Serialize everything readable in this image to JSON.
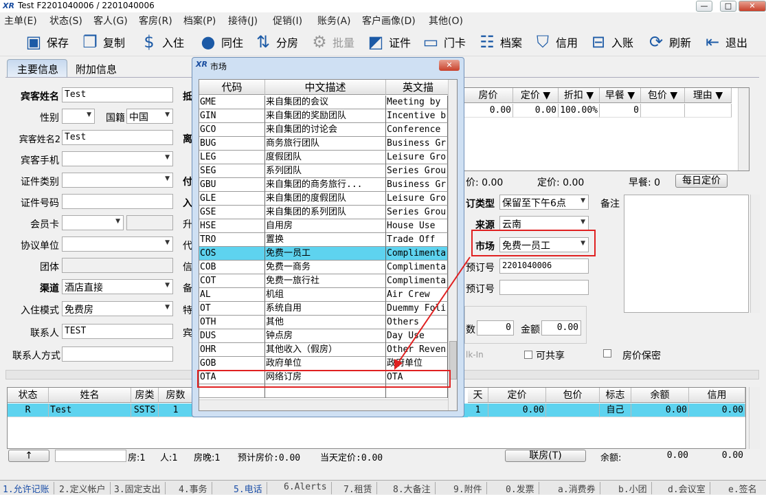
{
  "window": {
    "title": "Test F2201040006 / 2201040006",
    "logo": "XR"
  },
  "menu": [
    "主单(E)",
    "状态(S)",
    "客人(G)",
    "客房(R)",
    "档案(P)",
    "接待(J)",
    "促销(I)",
    "账务(A)",
    "客户画像(D)",
    "其他(O)"
  ],
  "toolbar": [
    {
      "label": "保存",
      "icon": "save-icon"
    },
    {
      "label": "复制",
      "icon": "copy-icon"
    },
    {
      "label": "入住",
      "icon": "money-bag-icon"
    },
    {
      "label": "同住",
      "icon": "person-icon"
    },
    {
      "label": "分房",
      "icon": "split-icon"
    },
    {
      "label": "批量",
      "icon": "gear-icon",
      "disabled": true
    },
    {
      "label": "证件",
      "icon": "id-icon"
    },
    {
      "label": "门卡",
      "icon": "card-icon"
    },
    {
      "label": "档案",
      "icon": "profile-icon"
    },
    {
      "label": "信用",
      "icon": "shield-icon"
    },
    {
      "label": "入账",
      "icon": "post-icon"
    },
    {
      "label": "刷新",
      "icon": "refresh-icon"
    },
    {
      "label": "退出",
      "icon": "exit-icon"
    }
  ],
  "tabs": [
    "主要信息",
    "附加信息"
  ],
  "form": {
    "guest_name_label": "宾客姓名",
    "guest_name": "Test",
    "gender_label": "性别",
    "nationality_label": "国籍",
    "nationality": "中国",
    "guest_name2_label": "宾客姓名2",
    "guest_name2": "Test",
    "mobile_label": "宾客手机",
    "id_type_label": "证件类别",
    "id_no_label": "证件号码",
    "member_label": "会员卡",
    "agreement_label": "协议单位",
    "group_label": "团体",
    "channel_label": "渠道",
    "channel": "酒店直接",
    "checkin_mode_label": "入住模式",
    "checkin_mode": "免费房",
    "contact_label": "联系人",
    "contact": "TEST",
    "contact_method_label": "联系人方式",
    "mid_labels": [
      "抵",
      "离",
      "付",
      "入",
      "升",
      "代",
      "信",
      "备",
      "特",
      "宾"
    ],
    "booking_type_label": "订类型",
    "booking_type": "保留至下午6点",
    "source_label": "来源",
    "source": "云南",
    "market_label": "市场",
    "market": "免费一员工",
    "booking_no_label": "预订号",
    "booking_no": "2201040006",
    "ext_booking_label": "预订号",
    "remark_label": "备注",
    "count_label": "数",
    "count_value": "0",
    "amount_label": "金额",
    "amount_value": "0.00",
    "walkin_label": "lk-In",
    "shareable_label": "可共享",
    "rate_private_label": "房价保密",
    "price_line": {
      "room_price": "价: 0.00",
      "set_price": "定价: 0.00",
      "breakfast": "早餐: 0"
    },
    "daily_price_button": "每日定价"
  },
  "rate_grid": {
    "headers": [
      "房价",
      "定价 ▼",
      "折扣 ▼",
      "早餐 ▼",
      "包价 ▼",
      "理由 ▼"
    ],
    "row": [
      "0.00",
      "0.00",
      "100.00%",
      "0",
      "",
      ""
    ]
  },
  "market_dialog": {
    "title": "市场",
    "logo": "XR",
    "headers": [
      "代码",
      "中文描述",
      "英文描"
    ],
    "rows": [
      [
        "GME",
        "来自集团的会议",
        "Meeting by"
      ],
      [
        "GIN",
        "来自集团的奖励团队",
        "Incentive b"
      ],
      [
        "GCO",
        "来自集团的讨论会",
        "Conference"
      ],
      [
        "BUG",
        "商务旅行团队",
        "Business Gr"
      ],
      [
        "LEG",
        "度假团队",
        "Leisure Gro"
      ],
      [
        "SEG",
        "系列团队",
        "Series Grou"
      ],
      [
        "GBU",
        "来自集团的商务旅行...",
        "Business Gr"
      ],
      [
        "GLE",
        "来自集团的度假团队",
        "Leisure Gro"
      ],
      [
        "GSE",
        "来自集团的系列团队",
        "Series Grou"
      ],
      [
        "HSE",
        "自用房",
        "House Use"
      ],
      [
        "TRO",
        "置换",
        "Trade Off"
      ],
      [
        "COS",
        "免费一员工",
        "Complimenta"
      ],
      [
        "COB",
        "免费一商务",
        "Complimenta"
      ],
      [
        "COT",
        "免费一旅行社",
        "Complimenta"
      ],
      [
        "AL",
        "机组",
        "Air Crew"
      ],
      [
        "OT",
        "系统自用",
        "Duemmy Foli"
      ],
      [
        "OTH",
        "其他",
        "Others"
      ],
      [
        "DUS",
        "钟点房",
        "Day Use"
      ],
      [
        "OHR",
        "其他收入（假房）",
        "Other Reven"
      ],
      [
        "GOB",
        "政府单位",
        "政府单位"
      ],
      [
        "OTA",
        "网络订房",
        "OTA"
      ]
    ],
    "selected_index": 11,
    "highlight_index": 20
  },
  "guest_list": {
    "headers": [
      "状态",
      "姓名",
      "房类",
      "房数",
      "天",
      "定价",
      "包价",
      "标志",
      "余额",
      "信用"
    ],
    "row": [
      "R",
      "Test",
      "SSTS",
      "1",
      "1",
      "0.00",
      "",
      "自己",
      "0.00",
      "0.00"
    ]
  },
  "summary": {
    "up_button": "↑",
    "rooms": "房:1",
    "persons": "人:1",
    "nights": "房晚:1",
    "expected": "预计房价:0.00",
    "today": "当天定价:0.00",
    "link_button": "联房(T)",
    "balance_label": "余额:",
    "balance": "0.00",
    "credit": "0.00"
  },
  "bottom_tabs": [
    "1.允许记账",
    "2.定义帐户",
    "3.固定支出",
    "4.事务",
    "5.电话",
    "6.Alerts",
    "7.租赁",
    "8.大备注",
    "9.附件",
    "0.发票",
    "a.消费券",
    "b.小团",
    "d.会议室",
    "e.签名"
  ]
}
